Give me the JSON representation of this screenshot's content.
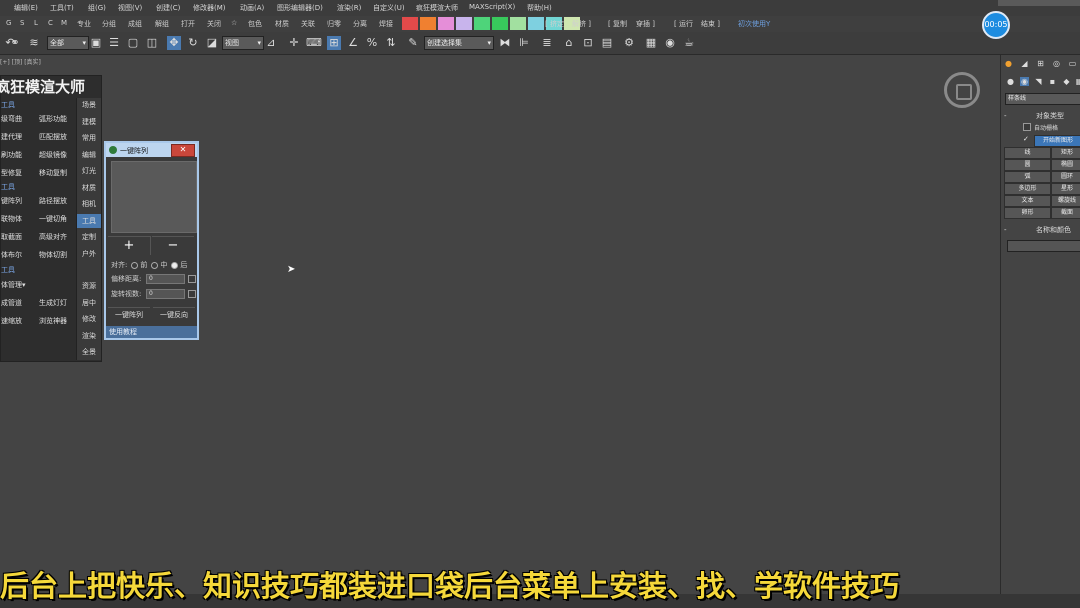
{
  "menu": [
    "编辑(E)",
    "工具(T)",
    "组(G)",
    "视图(V)",
    "创建(C)",
    "修改器(M)",
    "动画(A)",
    "图形编辑器(D)",
    "渲染(R)",
    "自定义(U)",
    "疯狂模渲大师",
    "MAXScript(X)",
    "帮助(H)"
  ],
  "toolbar2": {
    "letters": [
      "G",
      "S",
      "L",
      "C",
      "M"
    ],
    "labels": [
      "专业",
      "分组",
      "成组",
      "解组",
      "打开",
      "关闭",
      "☆",
      "包色",
      "材质",
      "关联",
      "归零",
      "分离",
      "焊接"
    ],
    "right_labels": [
      "[ 挤定",
      "解挤 ]",
      "[ 复制",
      "穿插 ]",
      "[ 运行",
      "结束 ]",
      "初次使用Y"
    ]
  },
  "toolbar3": {
    "selection_filter": "全部",
    "ref_coord": "视图",
    "named_selection": "创建选择集"
  },
  "viewport": {
    "label": "[+] [顶] [真实]"
  },
  "timer": "00:05",
  "plugin": {
    "title": "疯狂模渲大师",
    "sections": [
      "工具",
      "工具",
      "工具"
    ],
    "buttons": [
      [
        "级弯曲",
        "弧形功能"
      ],
      [
        "建代理",
        "匹配摆放"
      ],
      [
        "刷功能",
        "超级镜像"
      ],
      [
        "型修复",
        "移动复制"
      ],
      [
        "键阵列",
        "路径摆放"
      ],
      [
        "联物体",
        "一键切角"
      ],
      [
        "取截面",
        "高级对齐"
      ],
      [
        "体布尔",
        "物体切割"
      ],
      [
        "成管道",
        "生成灯灯"
      ],
      [
        "速缩放",
        "浏览神器"
      ]
    ],
    "manager": "体管理▾",
    "tabs": [
      "场景",
      "建模",
      "常用",
      "编辑",
      "灯光",
      "材质",
      "相机",
      "工具",
      "定制",
      "户外",
      "资源",
      "居中",
      "修改",
      "渲染",
      "全景"
    ],
    "active_tab": "工具"
  },
  "dialog": {
    "title": "一键阵列",
    "close": "✕",
    "plus": "+",
    "minus": "−",
    "align_label": "对齐:",
    "align_options": [
      "前",
      "中",
      "后"
    ],
    "offset_label": "偏移距离:",
    "offset_value": "0",
    "rotate_label": "旋转视数:",
    "rotate_value": "0",
    "btn_array": "一键阵列",
    "btn_reverse": "一键反向",
    "status": "使用教程"
  },
  "command_panel": {
    "dropdown": "样条线",
    "object_type_title": "对象类型",
    "auto_grid": "自动栅格",
    "start_new_shape": "开始新图形",
    "buttons": [
      [
        "线",
        "矩形"
      ],
      [
        "圆",
        "椭圆"
      ],
      [
        "弧",
        "圆环"
      ],
      [
        "多边形",
        "星形"
      ],
      [
        "文本",
        "螺旋线"
      ],
      [
        "卵形",
        "截面"
      ]
    ],
    "name_color_title": "名称和颜色"
  },
  "subtitle": "后台上把快乐、知识技巧都装进口袋后台菜单上安装、找、学软件技巧",
  "colors": {
    "swatches": [
      "#e24a4a",
      "#f08030",
      "#e58ed8",
      "#c8b4ec",
      "#4ed47a",
      "#38c95c",
      "#a2e0a0",
      "#7ed0e0",
      "#72d6d4",
      "#cfe6b0"
    ],
    "accent": "#1d8ce0",
    "subtitle": "#f5d83a"
  }
}
